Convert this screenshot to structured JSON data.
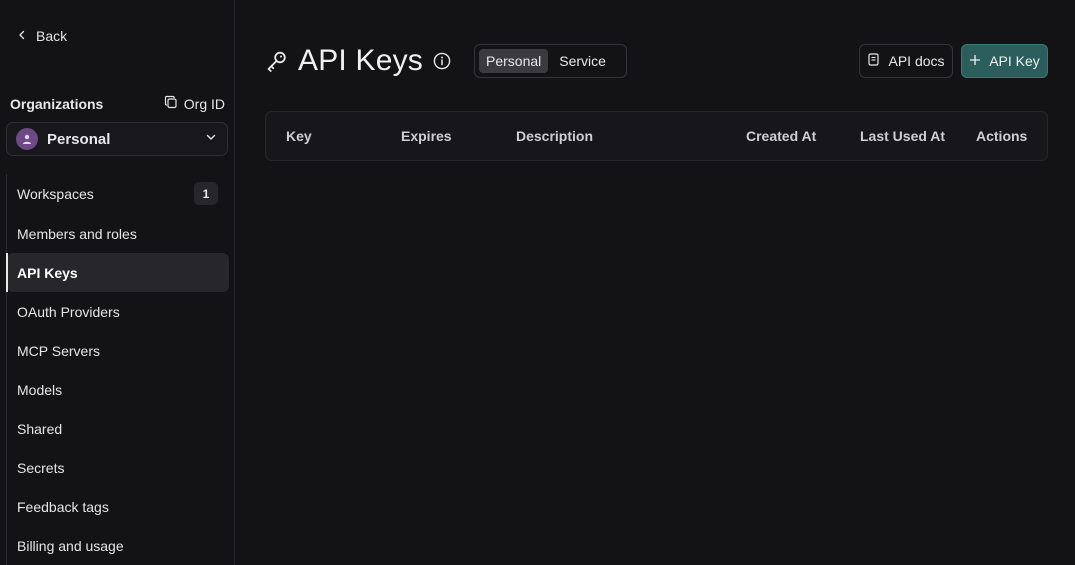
{
  "sidebar": {
    "back_label": "Back",
    "org_title": "Organizations",
    "org_id_label": "Org ID",
    "selected_org": "Personal",
    "items": [
      {
        "label": "Workspaces",
        "badge": "1"
      },
      {
        "label": "Members and roles"
      },
      {
        "label": "API Keys",
        "active": true
      },
      {
        "label": "OAuth Providers"
      },
      {
        "label": "MCP Servers"
      },
      {
        "label": "Models"
      },
      {
        "label": "Shared"
      },
      {
        "label": "Secrets"
      },
      {
        "label": "Feedback tags"
      },
      {
        "label": "Billing and usage"
      }
    ]
  },
  "header": {
    "title": "API Keys",
    "tabs": [
      "Personal",
      "Service"
    ],
    "active_tab": "Personal",
    "docs_label": "API docs",
    "add_label": "API Key"
  },
  "table": {
    "columns": [
      "Key",
      "Expires",
      "Description",
      "Created At",
      "Last Used At",
      "Actions"
    ]
  },
  "colors": {
    "background": "#131316",
    "accent": "#2a5d5b",
    "avatar": "#6d4a86"
  }
}
